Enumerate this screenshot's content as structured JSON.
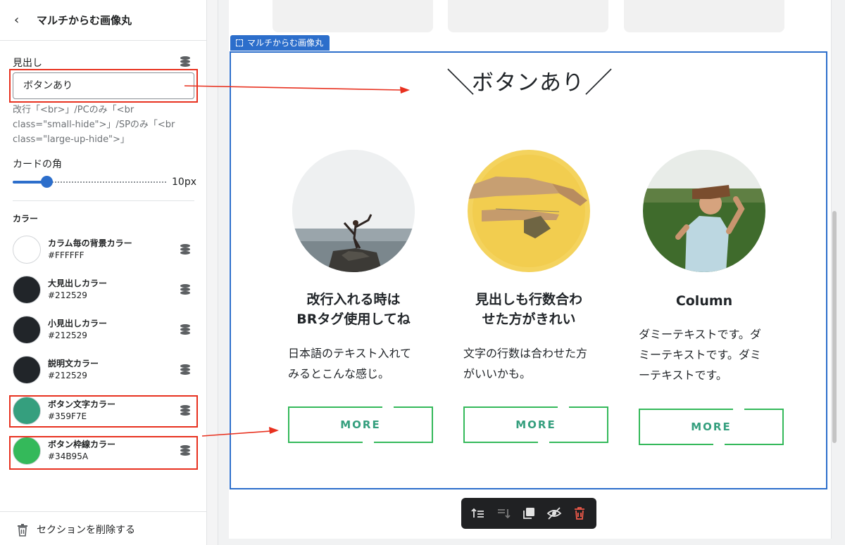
{
  "panel": {
    "title": "マルチからむ画像丸",
    "heading_label": "見出し",
    "heading_value": "ボタンあり",
    "help_text": "改行「<br>」/PCのみ「<br class=\"small-hide\">」/SPのみ「<br class=\"large-up-hide\">」",
    "corner_label": "カードの角",
    "corner_value": "10px",
    "corner_fraction": 0.22,
    "color_section": "カラー",
    "colors": [
      {
        "name": "カラム毎の背景カラー",
        "hex": "#FFFFFF"
      },
      {
        "name": "大見出しカラー",
        "hex": "#212529"
      },
      {
        "name": "小見出しカラー",
        "hex": "#212529"
      },
      {
        "name": "説明文カラー",
        "hex": "#212529"
      },
      {
        "name": "ボタン文字カラー",
        "hex": "#359F7E"
      },
      {
        "name": "ボタン枠線カラー",
        "hex": "#34B95A"
      }
    ],
    "delete_label": "セクションを削除する"
  },
  "preview": {
    "section_tag": "マルチからむ画像丸",
    "heading": "ボタンあり",
    "slash_left": "＼",
    "slash_right": "／",
    "columns": [
      {
        "title_lines": [
          "改行入れる時は",
          "BRタグ使用してね"
        ],
        "text_lines": [
          "日本語のテキスト入れて",
          "みるとこんな感じ。"
        ],
        "button": "MORE",
        "image": "yoga-by-the-sea"
      },
      {
        "title_lines": [
          "見出しも行数合わ",
          "せた方がきれい"
        ],
        "text_lines": [
          "文字の行数は合わせた方",
          "がいいかも。"
        ],
        "button": "MORE",
        "image": "hands-on-yellow"
      },
      {
        "title_lines": [
          "Column"
        ],
        "text_lines": [
          "ダミーテキストです。ダ",
          "ミーテキストです。ダミ",
          "ーテキストです。"
        ],
        "button": "MORE",
        "image": "man-with-hat-in-field"
      }
    ]
  },
  "icons": {
    "back": "chevron-left-icon",
    "dynamic_source": "database-stack-icon",
    "trash": "trash-icon",
    "toolbar": [
      "move-up-icon",
      "move-down-icon",
      "duplicate-icon",
      "hide-icon",
      "delete-icon"
    ]
  },
  "accent": "#2c6ecb",
  "annotation_color": "#e8311f"
}
